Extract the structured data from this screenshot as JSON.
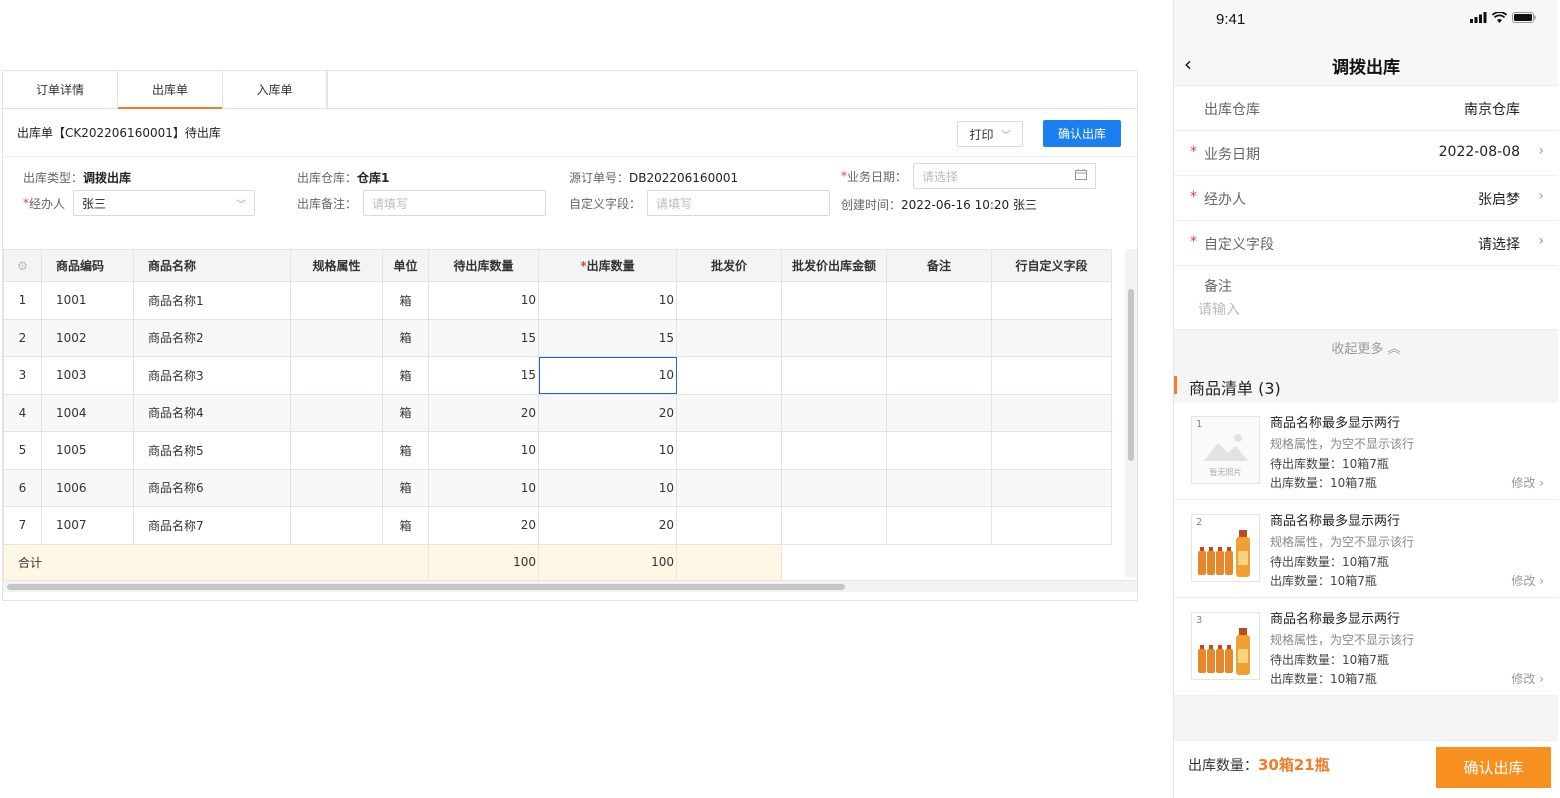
{
  "desktop": {
    "tabs": [
      "订单详情",
      "出库单",
      "入库单"
    ],
    "header_title": "出库单【CK202206160001】待出库",
    "print_label": "打印",
    "confirm_label": "确认出库",
    "form": {
      "type_label": "出库类型：",
      "type_value": "调拨出库",
      "warehouse_label": "出库仓库：",
      "warehouse_value": "仓库1",
      "source_label": "源订单号：",
      "source_value": "DB202206160001",
      "date_label": "业务日期：",
      "date_placeholder": "请选择",
      "handler_label": "经办人",
      "handler_value": "张三",
      "remark_label": "出库备注：",
      "remark_placeholder": "请填写",
      "custom_label": "自定义字段：",
      "custom_placeholder": "请填写",
      "created_label": "创建时间：",
      "created_value": "2022-06-16 10:20 张三"
    },
    "table": {
      "headers": [
        "商品编码",
        "商品名称",
        "规格属性",
        "单位",
        "待出库数量",
        "出库数量",
        "批发价",
        "批发价出库金额",
        "备注",
        "行自定义字段"
      ],
      "rows": [
        {
          "idx": "1",
          "code": "1001",
          "name": "商品名称1",
          "unit": "箱",
          "pending": "10",
          "out": "10"
        },
        {
          "idx": "2",
          "code": "1002",
          "name": "商品名称2",
          "unit": "箱",
          "pending": "15",
          "out": "15"
        },
        {
          "idx": "3",
          "code": "1003",
          "name": "商品名称3",
          "unit": "箱",
          "pending": "15",
          "out": "10"
        },
        {
          "idx": "4",
          "code": "1004",
          "name": "商品名称4",
          "unit": "箱",
          "pending": "20",
          "out": "20"
        },
        {
          "idx": "5",
          "code": "1005",
          "name": "商品名称5",
          "unit": "箱",
          "pending": "10",
          "out": "10"
        },
        {
          "idx": "6",
          "code": "1006",
          "name": "商品名称6",
          "unit": "箱",
          "pending": "10",
          "out": "10"
        },
        {
          "idx": "7",
          "code": "1007",
          "name": "商品名称7",
          "unit": "箱",
          "pending": "20",
          "out": "20"
        }
      ],
      "total_label": "合计",
      "total_pending": "100",
      "total_out": "100"
    },
    "accent_color": "#1a7ff0"
  },
  "mobile": {
    "time": "9:41",
    "title": "调拨出库",
    "fields": {
      "warehouse_label": "出库仓库",
      "warehouse_value": "南京仓库",
      "date_label": "业务日期",
      "date_value": "2022-08-08",
      "handler_label": "经办人",
      "handler_value": "张启梦",
      "custom_label": "自定义字段",
      "custom_value": "请选择",
      "note_label": "备注",
      "note_placeholder": "请输入"
    },
    "collapse_label": "收起更多",
    "list_title": "商品清单 (3)",
    "items": [
      {
        "idx": "1",
        "name": "商品名称最多显示两行",
        "attr": "规格属性，为空不显示该行",
        "pending": "待出库数量：10箱7瓶",
        "out": "出库数量：10箱7瓶",
        "edit": "修改",
        "placeholder": "暂无照片"
      },
      {
        "idx": "2",
        "name": "商品名称最多显示两行",
        "attr": "规格属性，为空不显示该行",
        "pending": "待出库数量：10箱7瓶",
        "out": "出库数量：10箱7瓶",
        "edit": "修改"
      },
      {
        "idx": "3",
        "name": "商品名称最多显示两行",
        "attr": "规格属性，为空不显示该行",
        "pending": "待出库数量：10箱7瓶",
        "out": "出库数量：10箱7瓶",
        "edit": "修改"
      }
    ],
    "bottom_label": "出库数量：",
    "bottom_qty": "30箱21瓶",
    "bottom_button": "确认出库",
    "accent_color": "#f7901e"
  }
}
